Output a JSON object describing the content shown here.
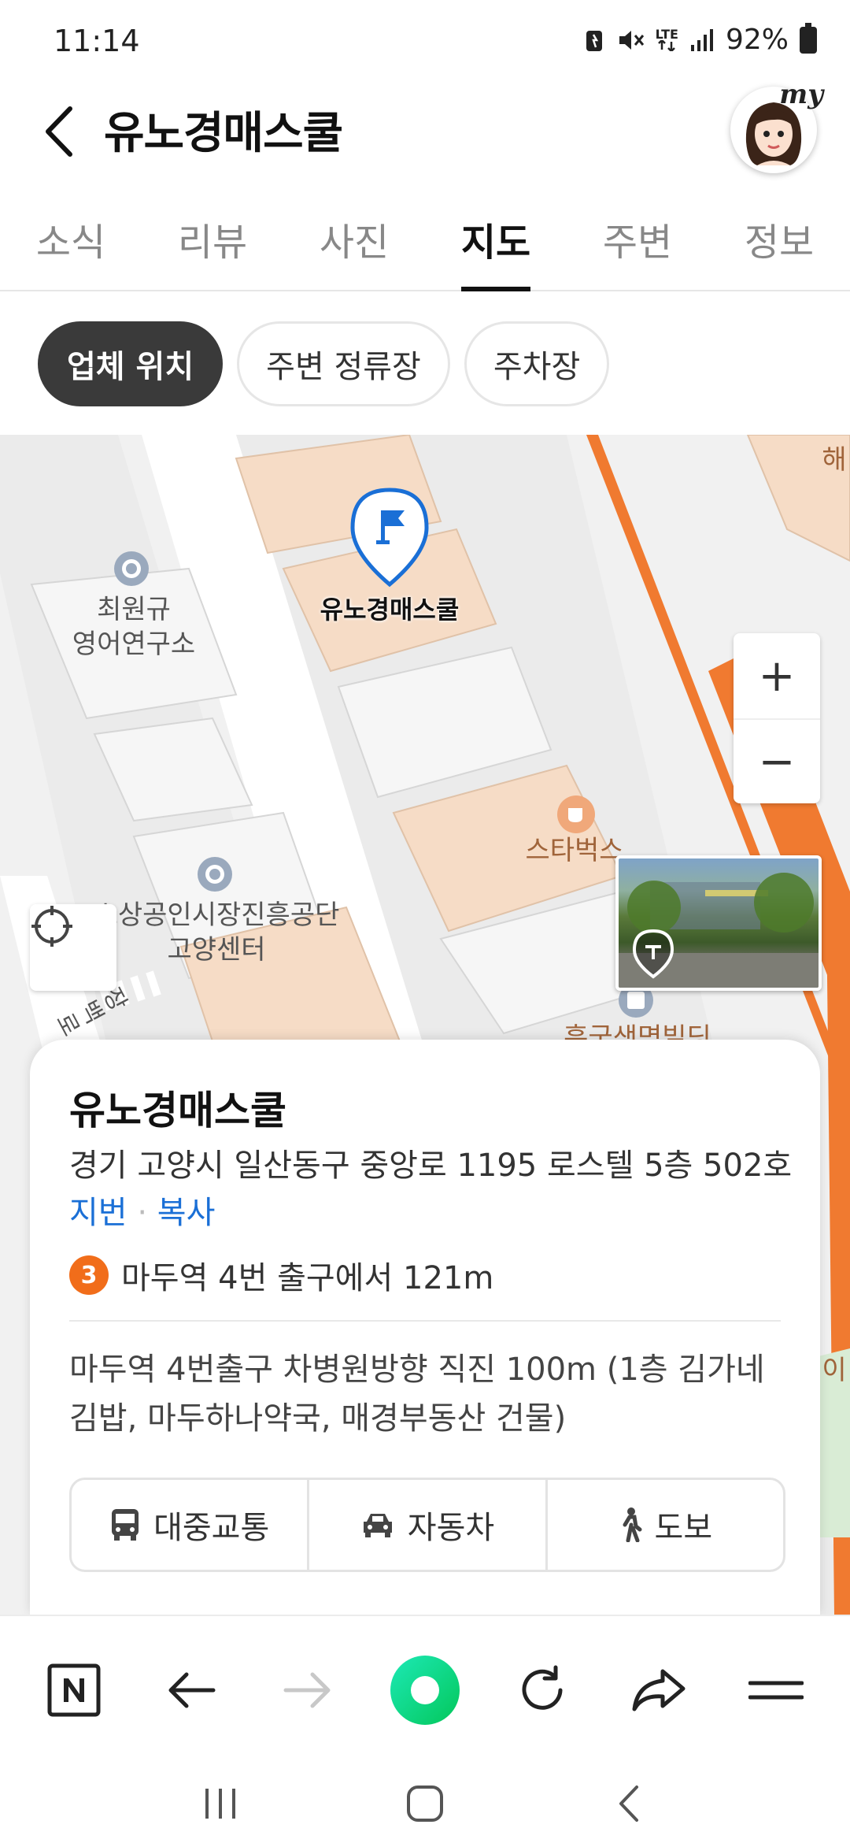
{
  "status_bar": {
    "time": "11:14",
    "network": "LTE",
    "battery": "92%",
    "icons": [
      "battery-saver-icon",
      "mute-icon",
      "lte-icon",
      "signal-icon",
      "battery-icon"
    ]
  },
  "header": {
    "title": "유노경매스쿨",
    "avatar_badge": "my"
  },
  "tabs": [
    {
      "label": "소식",
      "active": false
    },
    {
      "label": "리뷰",
      "active": false
    },
    {
      "label": "사진",
      "active": false
    },
    {
      "label": "지도",
      "active": true
    },
    {
      "label": "주변",
      "active": false
    },
    {
      "label": "정보",
      "active": false
    }
  ],
  "chips": [
    {
      "label": "업체 위치",
      "active": true
    },
    {
      "label": "주변 정류장",
      "active": false
    },
    {
      "label": "주차장",
      "active": false
    }
  ],
  "map": {
    "marker_label": "유노경매스쿨",
    "pois": {
      "poi1": "최원규\n영어연구소",
      "poi2": "스타벅스",
      "poi3": "소상공인시장진흥공단\n고양센터",
      "poi4": "흥국생명빌딩",
      "poi5": "해",
      "poi6": "장백로",
      "poi7": "이"
    },
    "zoom_in": "+",
    "zoom_out": "−"
  },
  "card": {
    "title": "유노경매스쿨",
    "address": "경기 고양시 일산동구 중앙로 1195 로스텔 5층 502호",
    "lot_link": "지번",
    "separator": "·",
    "copy_link": "복사",
    "subway_line": "3",
    "subway_text": "마두역 4번 출구에서 121m",
    "directions": "마두역 4번출구 차병원방향 직진 100m (1층 김가네김밥, 마두하나약국, 매경부동산 건물)",
    "routes": [
      {
        "label": "대중교통",
        "icon": "bus-icon"
      },
      {
        "label": "자동차",
        "icon": "car-icon"
      },
      {
        "label": "도보",
        "icon": "walk-icon"
      }
    ]
  },
  "colors": {
    "accent_blue": "#1a6fd6",
    "subway_orange": "#f16d1a",
    "road_orange": "#f07a30",
    "naver_green": "#03c75a"
  }
}
